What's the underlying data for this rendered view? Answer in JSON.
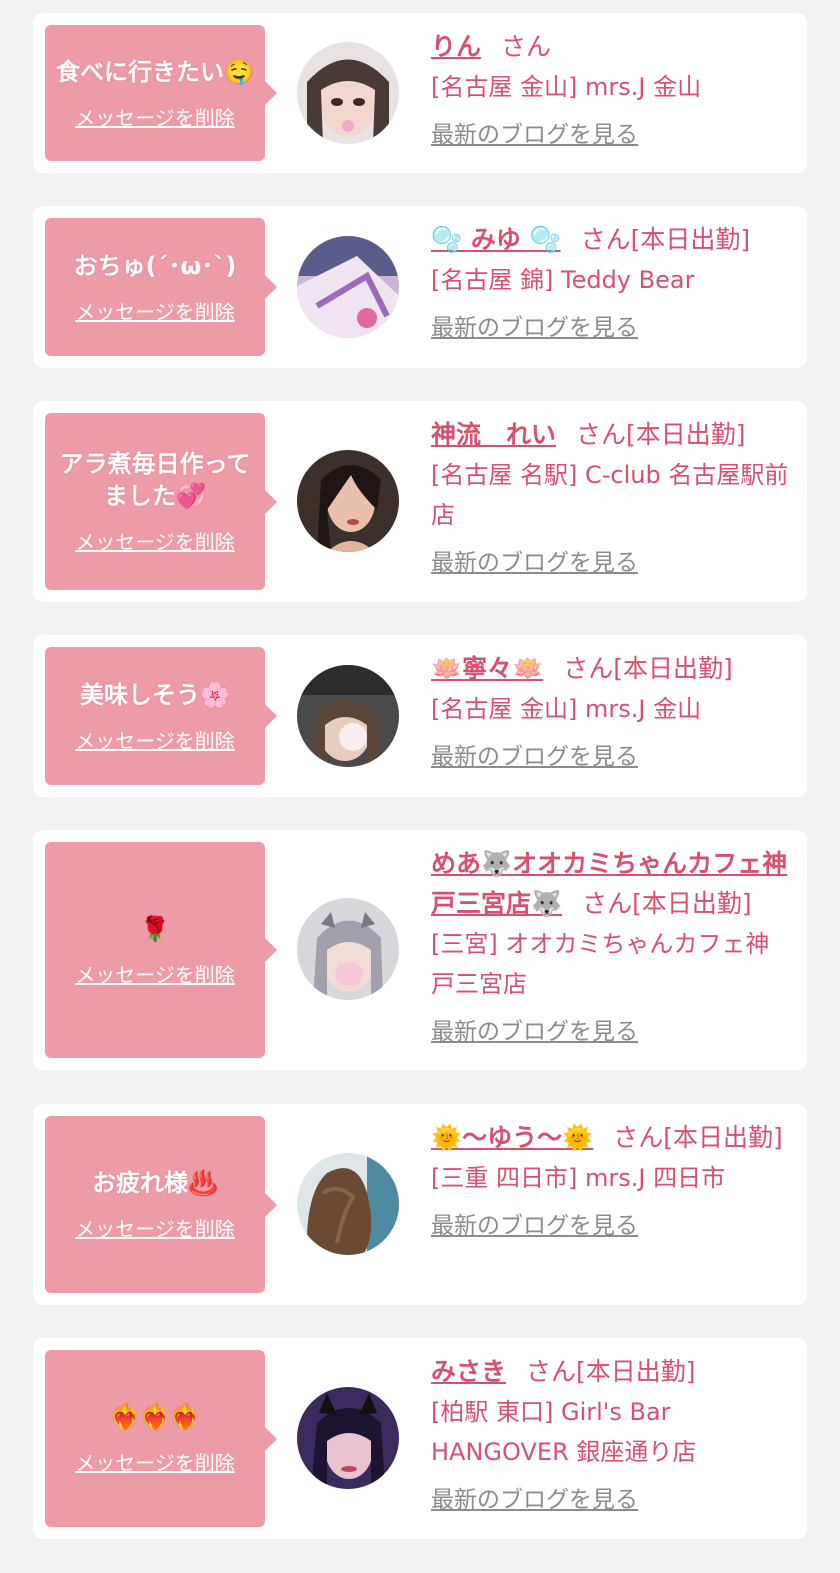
{
  "colors": {
    "page_bg": "#f2f2f2",
    "card_bg": "#ffffff",
    "bubble_bg": "#ee9ba8",
    "accent_text": "#d9506f",
    "muted_link": "#8c8c8c"
  },
  "labels": {
    "delete": "メッセージを削除",
    "blog": "最新のブログを見る"
  },
  "items": [
    {
      "message": "食べに行きたい🤤",
      "name": "りん",
      "suffix": "さん",
      "shop": "[名古屋 金山] mrs.J 金山",
      "avatar_icon": "profile-photo"
    },
    {
      "message": "おちゅ(´･ω･`)",
      "name": "🫧 みゆ 🫧",
      "suffix": "さん[本日出勤]",
      "shop": "[名古屋 錦] Teddy Bear",
      "avatar_icon": "profile-photo"
    },
    {
      "message": "アラ煮毎日作ってました💞",
      "name": "神流　れい",
      "suffix": "さん[本日出勤]",
      "shop": "[名古屋 名駅] C-club 名古屋駅前店",
      "avatar_icon": "profile-photo"
    },
    {
      "message": "美味しそう🌸",
      "name": "🪷寧々🪷",
      "suffix": "さん[本日出勤]",
      "shop": "[名古屋 金山] mrs.J 金山",
      "avatar_icon": "profile-photo"
    },
    {
      "message": "🌹",
      "name": "めあ🐺オオカミちゃんカフェ神戸三宮店🐺",
      "suffix": "さん[本日出勤]",
      "shop": "[三宮] オオカミちゃんカフェ神戸三宮店",
      "avatar_icon": "profile-photo"
    },
    {
      "message": "お疲れ様♨️",
      "name": "🌞〜ゆう〜🌞",
      "suffix": "さん[本日出勤]",
      "shop": "[三重 四日市] mrs.J 四日市",
      "avatar_icon": "profile-photo"
    },
    {
      "message": "❤️‍🔥❤️‍🔥❤️‍🔥",
      "name": "みさき",
      "suffix": "さん[本日出勤]",
      "shop": "[柏駅 東口] Girl's Bar HANGOVER 銀座通り店",
      "avatar_icon": "profile-photo"
    }
  ]
}
